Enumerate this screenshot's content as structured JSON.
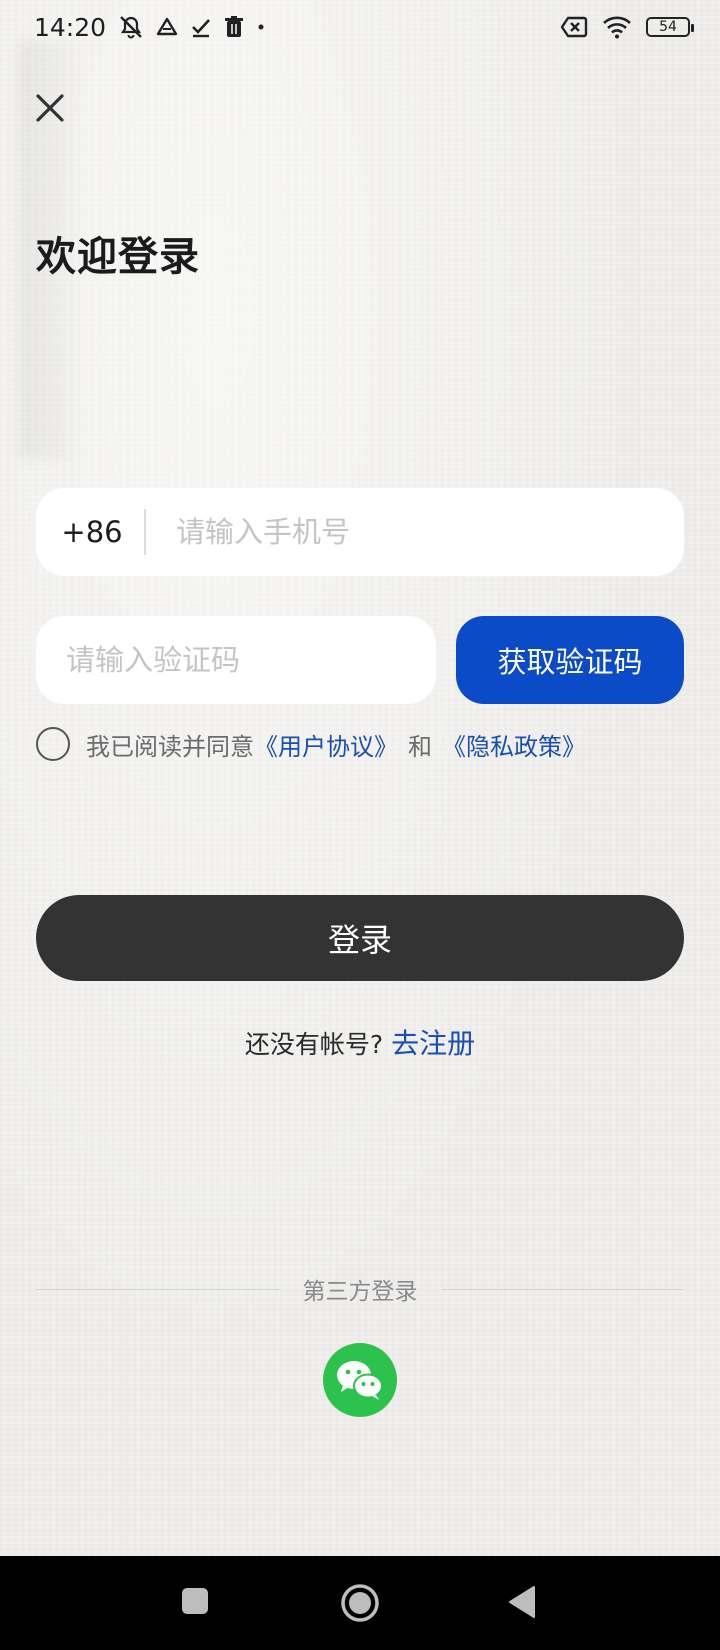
{
  "status_bar": {
    "time": "14:20",
    "battery": "54",
    "left_icons": [
      "bell-off-icon",
      "drive-icon",
      "check-icon",
      "trash-icon",
      "dot-icon"
    ],
    "right_icons": [
      "no-sim-icon",
      "wifi-icon",
      "battery-icon"
    ]
  },
  "header": {
    "title": "欢迎登录"
  },
  "phone": {
    "country_code": "+86",
    "value": "",
    "placeholder": "请输入手机号"
  },
  "verification": {
    "value": "",
    "placeholder": "请输入验证码",
    "get_code_label": "获取验证码"
  },
  "agreement": {
    "checked": false,
    "prefix": "我已阅读并同意",
    "user_agreement": "《用户协议》",
    "and": "和",
    "privacy_policy": "《隐私政策》"
  },
  "login": {
    "label": "登录"
  },
  "register": {
    "prompt": "还没有帐号?",
    "link": "去注册"
  },
  "third_party": {
    "label": "第三方登录",
    "providers": [
      "wechat-icon"
    ]
  },
  "colors": {
    "accent": "#0b4bc7",
    "link": "#1a4fb0",
    "login_button": "#333333",
    "wechat": "#2dc24e"
  }
}
